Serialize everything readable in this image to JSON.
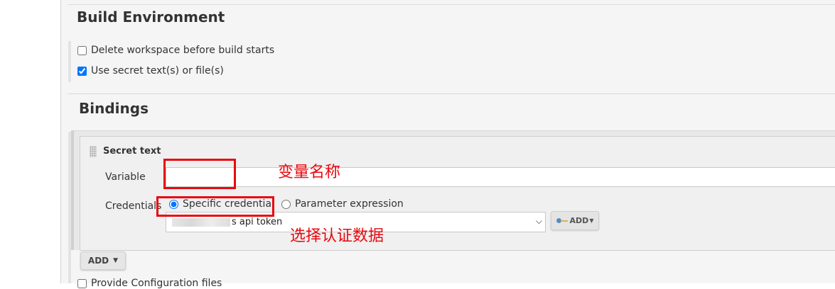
{
  "sections": {
    "build_environment": "Build Environment",
    "bindings": "Bindings"
  },
  "build_env": {
    "delete_workspace": {
      "label": "Delete workspace before build starts",
      "checked": false
    },
    "use_secret": {
      "label": "Use secret text(s) or file(s)",
      "checked": true
    }
  },
  "binding": {
    "title": "Secret text",
    "variable_label": "Variable",
    "variable_value": "",
    "credentials_label": "Credentials",
    "radio_specific": "Specific credential",
    "radio_parameter": "Parameter expression",
    "selected_credential": "s api token",
    "add_key_button": "ADD",
    "add_button": "ADD"
  },
  "bottom_item": {
    "label": "Provide Configuration files",
    "checked": false
  },
  "annotations": {
    "variable_name": "变量名称",
    "select_credential": "选择认证数据"
  },
  "colors": {
    "annotation": "#e8080f",
    "radio": "#1a73e8"
  }
}
